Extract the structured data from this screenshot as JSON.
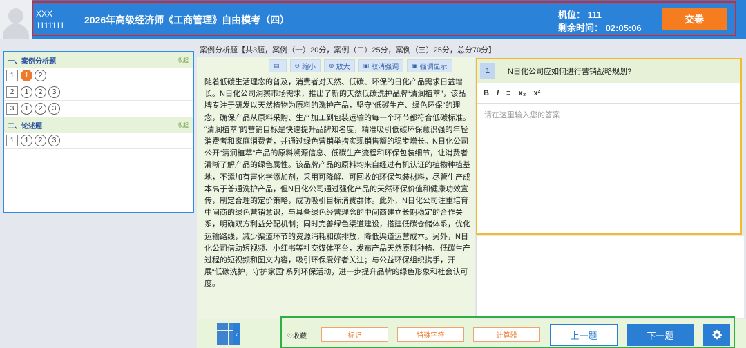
{
  "header": {
    "user_name": "XXX",
    "user_id": "1111111",
    "exam_title": "2026年高级经济师《工商管理》自由模考（四）",
    "seat": "机位：  111",
    "remaining_time": "剩余时间：  02:05:06",
    "submit_label": "交卷"
  },
  "sidebar": {
    "sections": [
      {
        "title": "一、案例分析题",
        "collapse_label": "收起",
        "rows": [
          {
            "num": "1",
            "questions": [
              "1",
              "2"
            ]
          },
          {
            "num": "2",
            "questions": [
              "1",
              "2",
              "3"
            ]
          },
          {
            "num": "3",
            "questions": [
              "1",
              "2",
              "3"
            ]
          }
        ]
      },
      {
        "title": "二、论述题",
        "collapse_label": "收起",
        "rows": [
          {
            "num": "1",
            "questions": [
              "1",
              "2",
              "3"
            ]
          }
        ]
      }
    ],
    "active_question": "1-1"
  },
  "info_line": "案例分析题【共3题，案例（一）20分，案例（二）25分，案例（三）25分，总分70分】",
  "toolbar": {
    "layout_icon": "layout-icon",
    "zoom_out": "缩小",
    "zoom_in": "放大",
    "cancel_highlight": "取消强调",
    "highlight_show": "强调显示"
  },
  "passage": [
    "随着低碳生活理念的普及，消费者对天然、低碳、环保的日化产品需求日益增长。N日化公司洞察市场需求，推出了新的天然低碳洗护品牌“清润植萃”，该品牌专注于研发以天然植物为原料的洗护产品，坚守“低碳生产、绿色环保”的理念，确保产品从原料采购、生产加工到包装运输的每一个环节都符合低碳标准。",
    "“清润植萃”的营销目标是快速提升品牌知名度，精准吸引低碳环保意识强的年轻消费者和家庭消费者，并通过绿色营销举措实现销售额的稳步增长。N日化公司公开“清润植萃”产品的原料溯源信息、低碳生产流程和环保包装细节，让消费者清晰了解产品的绿色属性。该品牌产品的原料均来自经过有机认证的植物种植基地，不添加有害化学添加剂，采用可降解、可回收的环保包装材料，尽管生产成本高于普通洗护产品，但N日化公司通过强化产品的天然环保价值和健康功效宣传，制定合理的定价策略，成功吸引目标消费群体。此外，N日化公司注重培育中间商的绿色营销意识，与具备绿色经营理念的中间商建立长期稳定的合作关系，明确双方利益分配机制；同时完善绿色渠道建设，搭建低碳仓储体系，优化运输路线，减少渠道环节的资源消耗和碳排放，降低渠道运营成本。另外，N日化公司借助短视频、小红书等社交媒体平台，发布产品天然原料种植、低碳生产过程的短视频和图文内容，吸引环保爱好者关注；与公益环保组织携手，开展“低碳洗护，守护家园”系列环保活动，进一步提升品牌的绿色形象和社会认可度。"
  ],
  "question": {
    "number": "1",
    "text": "N日化公司应如何进行营销战略规划?",
    "editor_tools": [
      "B",
      "I",
      "≡",
      "x₂",
      "x²"
    ],
    "answer_placeholder": "请在这里输入您的答案"
  },
  "bottom": {
    "favorite_label": "收藏",
    "mark_label": "标记",
    "special_char_label": "特殊字符",
    "calculator_label": "计算器",
    "prev_label": "上一题",
    "next_label": "下一题",
    "collapse_arrow": "‹"
  },
  "colors": {
    "header_blue": "#2a83d8",
    "submit_orange": "#f57c1f",
    "active_orange": "#ee7a2c"
  }
}
